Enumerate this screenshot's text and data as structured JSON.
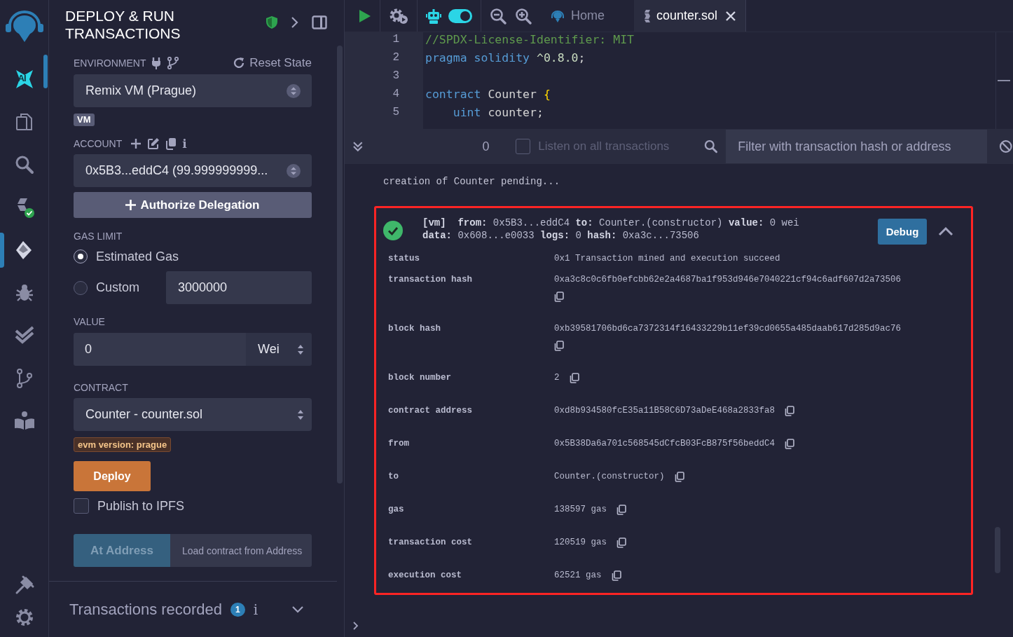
{
  "icon_bar": {
    "items": [
      {
        "kind": "ai",
        "label": "AI",
        "selected": false
      },
      {
        "kind": "files",
        "selected": false
      },
      {
        "kind": "search",
        "selected": false
      },
      {
        "kind": "compiler",
        "selected": false
      },
      {
        "kind": "deploy",
        "selected": true
      },
      {
        "kind": "debugger",
        "selected": false
      },
      {
        "kind": "tests",
        "selected": false
      },
      {
        "kind": "git",
        "selected": false
      },
      {
        "kind": "learn",
        "selected": false
      }
    ],
    "bottom": [
      {
        "kind": "plugin",
        "selected": false
      },
      {
        "kind": "settings",
        "selected": false
      }
    ]
  },
  "panel": {
    "title": "DEPLOY & RUN TRANSACTIONS",
    "environment": {
      "label": "ENVIRONMENT",
      "reset": "Reset State",
      "value": "Remix VM (Prague)",
      "badge": "VM"
    },
    "account": {
      "label": "ACCOUNT",
      "info": "i",
      "value": "0x5B3...eddC4 (99.999999999..."
    },
    "authorize_button": "Authorize Delegation",
    "gas_limit": {
      "label": "GAS LIMIT",
      "options": [
        {
          "label": "Estimated Gas",
          "selected": true
        },
        {
          "label": "Custom",
          "selected": false
        }
      ],
      "custom_value": "3000000"
    },
    "value": {
      "label": "VALUE",
      "amount": "0",
      "unit": "Wei"
    },
    "contract": {
      "label": "CONTRACT",
      "value": "Counter - counter.sol",
      "evm_badge": "evm version: prague"
    },
    "deploy_button": "Deploy",
    "publish": {
      "label": "Publish to IPFS",
      "checked": false
    },
    "at_address": {
      "button": "At Address",
      "placeholder": "Load contract from Address"
    },
    "transactions_recorded": {
      "label": "Transactions recorded",
      "count": "1",
      "info": "i",
      "expanded": false
    }
  },
  "toolbar": {
    "copilot_on": true
  },
  "tabs": [
    {
      "label": "Home",
      "selected": false
    },
    {
      "label": "counter.sol",
      "selected": true
    }
  ],
  "editor": {
    "lines": [
      {
        "number": "1",
        "tokens": [
          {
            "kind": "comment",
            "text": "//SPDX-License-Identifier: MIT"
          }
        ]
      },
      {
        "number": "2",
        "tokens": [
          {
            "kind": "keyword",
            "text": "pragma solidity "
          },
          {
            "kind": "number",
            "text": "^0.8.0"
          },
          {
            "kind": "plain",
            "text": ";"
          }
        ]
      },
      {
        "number": "3"
      },
      {
        "number": "4",
        "tokens": [
          {
            "kind": "keyword",
            "text": "contract "
          },
          {
            "kind": "plain",
            "text": "Counter "
          },
          {
            "kind": "brace",
            "text": "{"
          }
        ]
      },
      {
        "number": "5",
        "tokens": [
          {
            "kind": "keyword",
            "text": "    uint "
          },
          {
            "kind": "plain",
            "text": "counter;"
          }
        ]
      }
    ]
  },
  "terminal": {
    "count": "0",
    "listen": {
      "label": "Listen on all transactions",
      "checked": false
    },
    "filter_placeholder": "Filter with transaction hash or address",
    "log": "creation of Counter pending...",
    "transaction": {
      "expanded": true,
      "debug_button": "Debug",
      "summary": [
        "**[vm]**  **from:** 0x5B3...eddC4 **to:** Counter.(constructor) **value:** 0 wei",
        "**data:** 0x608...e0033 **logs:** 0 **hash:** 0xa3c...73506"
      ],
      "details": [
        {
          "key": "status",
          "value": "0x1 Transaction mined and execution succeed",
          "copyable": false
        },
        {
          "key": "transaction hash",
          "value": "0xa3c8c0c6fb0efcbb62e2a4687ba1f953d946e7040221cf94c6adf607d2a73506",
          "copyable": true
        },
        {
          "key": "block hash",
          "value": "0xb39581706bd6ca7372314f16433229b11ef39cd0655a485daab617d285d9ac76",
          "copyable": true
        },
        {
          "key": "block number",
          "value": "2",
          "copyable": true
        },
        {
          "key": "contract address",
          "value": "0xd8b934580fcE35a11B58C6D73aDeE468a2833fa8",
          "copyable": true
        },
        {
          "key": "from",
          "value": "0x5B38Da6a701c568545dCfcB03FcB875f56beddC4",
          "copyable": true
        },
        {
          "key": "to",
          "value": "Counter.(constructor)",
          "copyable": true
        },
        {
          "key": "gas",
          "value": "138597 gas",
          "copyable": true
        },
        {
          "key": "transaction cost",
          "value": "120519 gas",
          "copyable": true
        },
        {
          "key": "execution cost",
          "value": "62521 gas",
          "copyable": true
        }
      ]
    }
  }
}
